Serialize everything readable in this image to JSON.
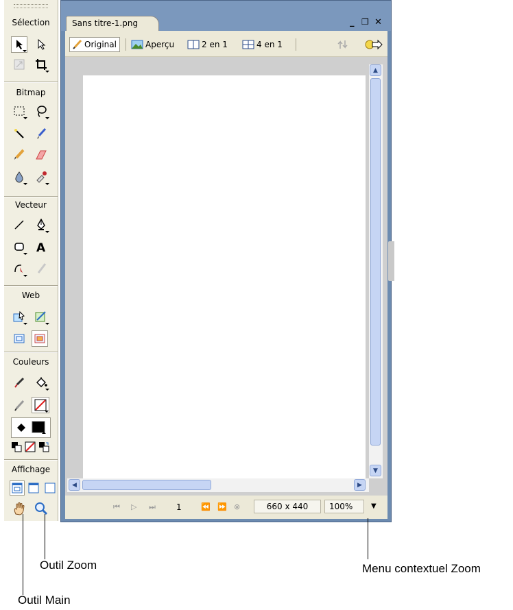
{
  "toolbar": {
    "sections": {
      "selection": "Sélection",
      "bitmap": "Bitmap",
      "vecteur": "Vecteur",
      "web": "Web",
      "couleurs": "Couleurs",
      "affichage": "Affichage"
    }
  },
  "document": {
    "tab_title": "Sans titre-1.png",
    "views": {
      "original": "Original",
      "apercu": "Aperçu",
      "deux_en_un": "2 en 1",
      "quatre_en_un": "4 en 1"
    },
    "status": {
      "frame": "1",
      "dimensions": "660 x 440",
      "zoom": "100%"
    }
  },
  "callouts": {
    "zoom_tool": "Outil Zoom",
    "zoom_menu": "Menu contextuel Zoom",
    "hand_tool": "Outil Main"
  },
  "colors": {
    "window_blue": "#6c8bb0",
    "panel_beige": "#ece9d8",
    "scroll_blue": "#c6d5f4"
  }
}
